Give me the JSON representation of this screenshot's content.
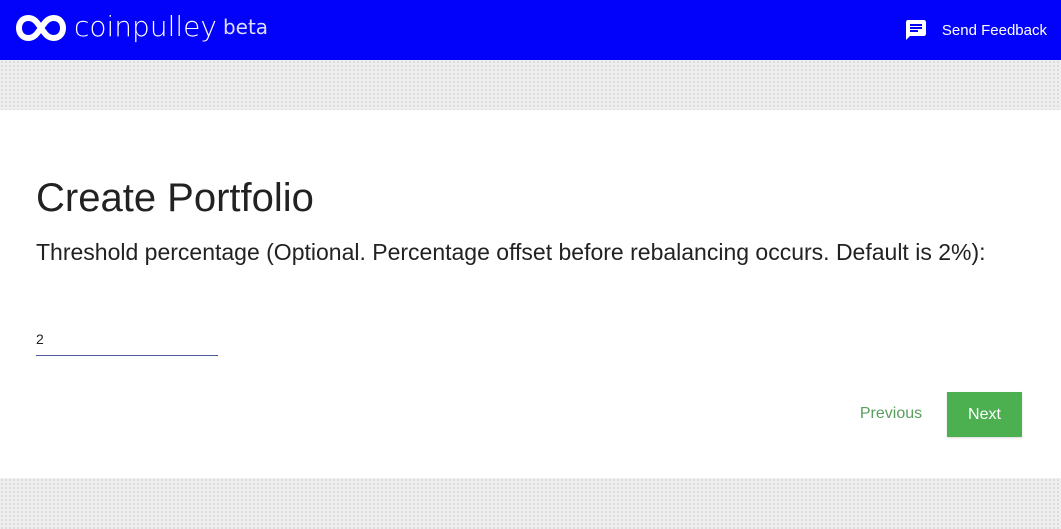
{
  "header": {
    "brand": "coinpulley",
    "badge": "beta",
    "logo_icon": "infinity-icon",
    "feedback_icon": "chat-icon",
    "feedback_label": "Send Feedback",
    "color": "#0202fb"
  },
  "form": {
    "title": "Create Portfolio",
    "question": "Threshold percentage (Optional. Percentage offset before rebalancing occurs. Default is 2%):",
    "threshold_value": "2",
    "previous_label": "Previous",
    "next_label": "Next",
    "next_color": "#4caf50",
    "previous_color": "#5a9e5c"
  }
}
